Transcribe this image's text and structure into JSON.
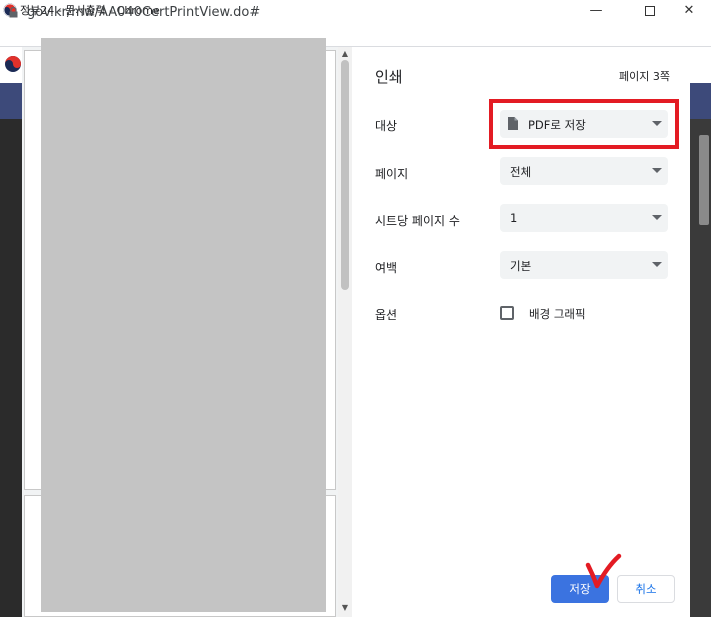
{
  "window": {
    "title": "정부24 - 문서출력 - Chrome",
    "minimize_icon": "minimize-icon",
    "maximize_icon": "maximize-icon",
    "close_icon": "close-icon"
  },
  "address_bar": {
    "url": "gov.kr/mw/AA040CertPrintView.do#",
    "lock_icon": "lock-icon"
  },
  "print_dialog": {
    "title": "인쇄",
    "page_count": "페이지 3쪽",
    "destination": {
      "label": "대상",
      "value": "PDF로 저장",
      "icon": "document-icon"
    },
    "pages": {
      "label": "페이지",
      "value": "전체"
    },
    "pages_per_sheet": {
      "label": "시트당 페이지 수",
      "value": "1"
    },
    "margins": {
      "label": "여백",
      "value": "기본"
    },
    "options": {
      "label": "옵션",
      "background_graphics": "배경 그래픽",
      "background_graphics_checked": false
    },
    "save_button": "저장",
    "cancel_button": "취소"
  },
  "annotations": {
    "highlight_color": "#e31b23",
    "checkmark_color": "#e31b23"
  },
  "colors": {
    "primary_button": "#3b73e0",
    "page_nav": "#3d4a7a"
  }
}
